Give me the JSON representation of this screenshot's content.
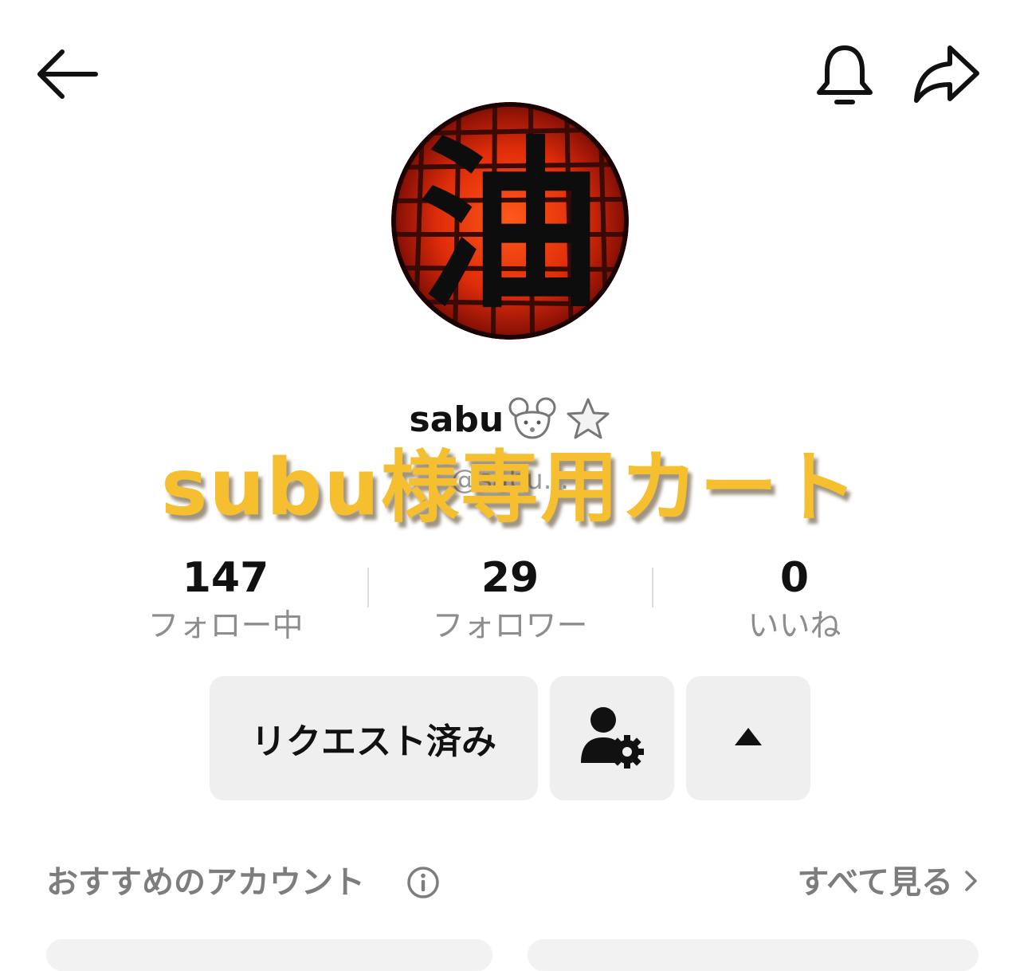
{
  "header": {
    "back_icon": "arrow-left-icon",
    "bell_icon": "bell-icon",
    "share_icon": "share-arrow-icon"
  },
  "profile": {
    "avatar_icon": "oil-kanji-lantern-avatar",
    "avatar_kanji": "油",
    "username": "sabu",
    "username_emojis": [
      "mouse-icon",
      "star-outline-icon"
    ],
    "handle": "@sabu..."
  },
  "overlay": {
    "banner_text": "subu様専用カート",
    "color": "#f6bf2f"
  },
  "stats": [
    {
      "value": "147",
      "label": "フォロー中"
    },
    {
      "value": "29",
      "label": "フォロワー"
    },
    {
      "value": "0",
      "label": "いいね"
    }
  ],
  "actions": {
    "request_label": "リクエスト済み",
    "person_settings_icon": "person-gear-icon",
    "expand_icon": "triangle-up-icon"
  },
  "recommend": {
    "title": "おすすめのアカウント",
    "info_icon": "info-icon",
    "see_all_label": "すべて見る",
    "see_all_icon": "chevron-right-icon"
  }
}
